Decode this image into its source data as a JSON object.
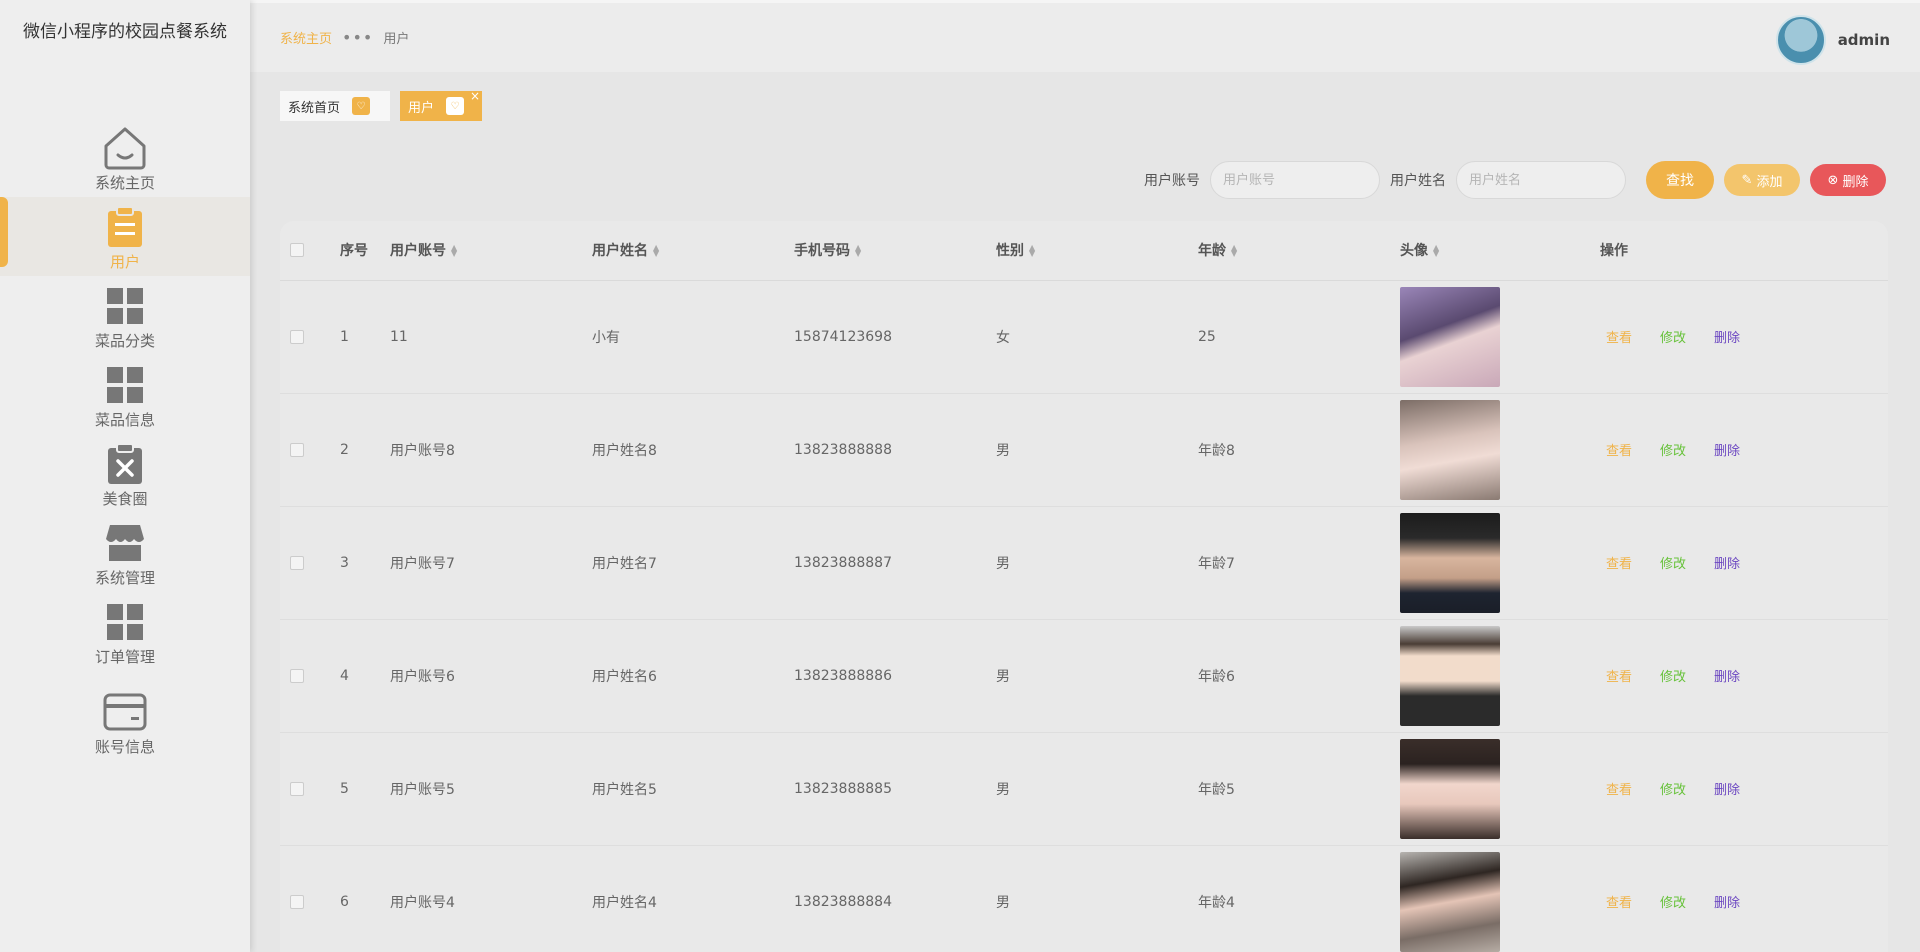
{
  "app": {
    "title": "微信小程序的校园点餐系统"
  },
  "sidebar": {
    "items": [
      {
        "label": "系统主页",
        "icon": "home-icon"
      },
      {
        "label": "用户",
        "icon": "clipboard-icon",
        "active": true
      },
      {
        "label": "菜品分类",
        "icon": "grid-icon"
      },
      {
        "label": "菜品信息",
        "icon": "grid-icon"
      },
      {
        "label": "美食圈",
        "icon": "clipboard-x-icon"
      },
      {
        "label": "系统管理",
        "icon": "store-icon"
      },
      {
        "label": "订单管理",
        "icon": "grid-icon"
      },
      {
        "label": "账号信息",
        "icon": "card-icon"
      }
    ]
  },
  "header": {
    "breadcrumb": {
      "home": "系统主页",
      "current": "用户"
    },
    "username": "admin"
  },
  "tags": [
    {
      "label": "系统首页"
    },
    {
      "label": "用户",
      "active": true,
      "close": "×"
    }
  ],
  "search": {
    "account_label": "用户账号",
    "account_placeholder": "用户账号",
    "name_label": "用户姓名",
    "name_placeholder": "用户姓名",
    "find_label": "查找",
    "add_label": "添加",
    "delete_label": "删除"
  },
  "table": {
    "columns": {
      "index": "序号",
      "account": "用户账号",
      "name": "用户姓名",
      "phone": "手机号码",
      "sex": "性别",
      "age": "年龄",
      "avatar": "头像",
      "ops": "操作"
    },
    "ops": {
      "view": "查看",
      "edit": "修改",
      "delete": "删除"
    },
    "rows": [
      {
        "index": "1",
        "account": "11",
        "name": "小有",
        "phone": "15874123698",
        "sex": "女",
        "age": "25"
      },
      {
        "index": "2",
        "account": "用户账号8",
        "name": "用户姓名8",
        "phone": "13823888888",
        "sex": "男",
        "age": "年龄8"
      },
      {
        "index": "3",
        "account": "用户账号7",
        "name": "用户姓名7",
        "phone": "13823888887",
        "sex": "男",
        "age": "年龄7"
      },
      {
        "index": "4",
        "account": "用户账号6",
        "name": "用户姓名6",
        "phone": "13823888886",
        "sex": "男",
        "age": "年龄6"
      },
      {
        "index": "5",
        "account": "用户账号5",
        "name": "用户姓名5",
        "phone": "13823888885",
        "sex": "男",
        "age": "年龄5"
      },
      {
        "index": "6",
        "account": "用户账号4",
        "name": "用户姓名4",
        "phone": "13823888884",
        "sex": "男",
        "age": "年龄4"
      }
    ]
  },
  "colors": {
    "accent": "#f0b349",
    "danger": "#e8575a",
    "edit": "#67c23a",
    "delete_link": "#6b46c1"
  }
}
